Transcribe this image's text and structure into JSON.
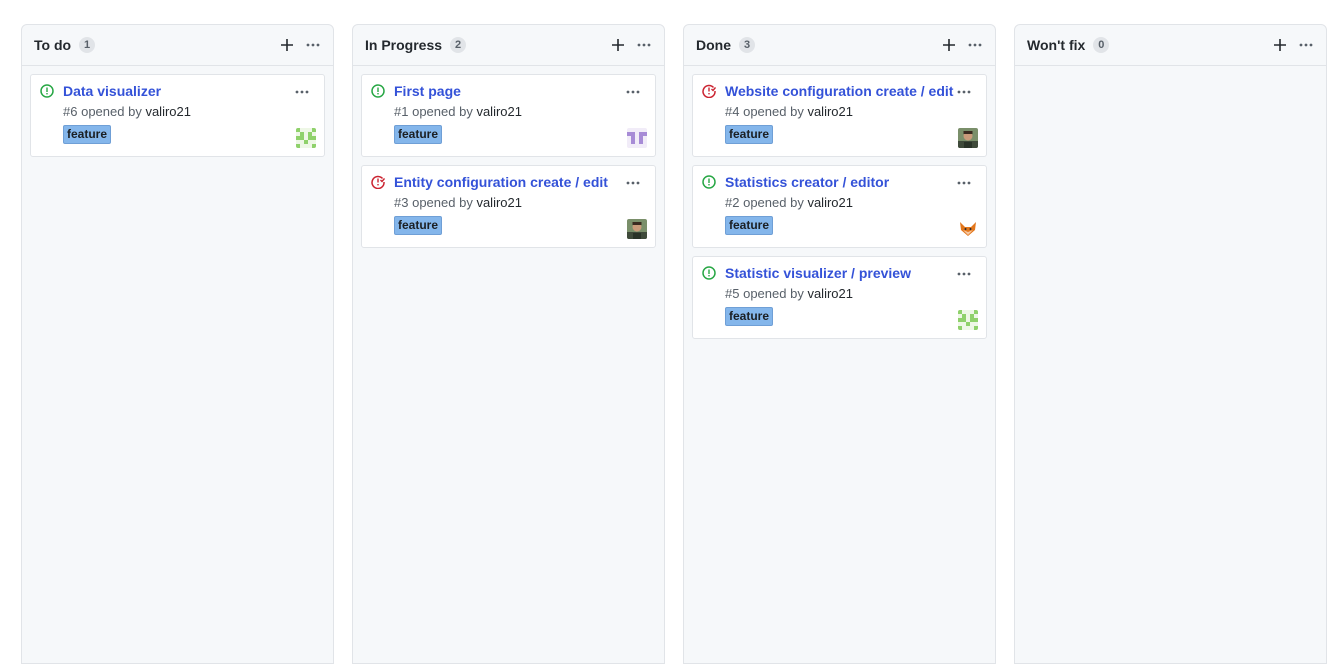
{
  "columns": [
    {
      "title": "To do",
      "count": "1",
      "cards": [
        {
          "state": "open",
          "title": "Data visualizer",
          "number": "#6",
          "opened_by_text": "opened by",
          "user": "valiro21",
          "label": "feature",
          "avatar": "identicon-green"
        }
      ]
    },
    {
      "title": "In Progress",
      "count": "2",
      "cards": [
        {
          "state": "open",
          "title": "First page",
          "number": "#1",
          "opened_by_text": "opened by",
          "user": "valiro21",
          "label": "feature",
          "avatar": "identicon-purple"
        },
        {
          "state": "closed",
          "title": "Entity configuration create / edit",
          "number": "#3",
          "opened_by_text": "opened by",
          "user": "valiro21",
          "label": "feature",
          "avatar": "photo-avatar"
        }
      ]
    },
    {
      "title": "Done",
      "count": "3",
      "cards": [
        {
          "state": "closed",
          "title": "Website configuration create / edit",
          "number": "#4",
          "opened_by_text": "opened by",
          "user": "valiro21",
          "label": "feature",
          "avatar": "photo-avatar"
        },
        {
          "state": "open",
          "title": "Statistics creator / editor",
          "number": "#2",
          "opened_by_text": "opened by",
          "user": "valiro21",
          "label": "feature",
          "avatar": "fox-avatar"
        },
        {
          "state": "open",
          "title": "Statistic visualizer / preview",
          "number": "#5",
          "opened_by_text": "opened by",
          "user": "valiro21",
          "label": "feature",
          "avatar": "identicon-green"
        }
      ]
    },
    {
      "title": "Won't fix",
      "count": "0",
      "cards": []
    }
  ],
  "colors": {
    "open": "#28a745",
    "closed": "#cb2431",
    "link": "#3452d8",
    "label": "#84b6eb"
  }
}
